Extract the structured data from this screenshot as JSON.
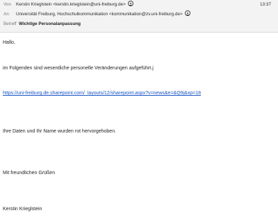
{
  "header": {
    "from_label": "Von",
    "from_value": "Kerstin Krieglstein <kerstin.krieglstein@uni-freiburg.de>",
    "to_label": "An",
    "to_value": "Universität Freiburg, Hochschulkommunikation <kommunikation@zv.uni-freiburg.de>",
    "subject_label": "Betreff",
    "subject_value": "Wichtige Personalanpassung",
    "time": "13:37",
    "icons": [
      "contact-icon",
      "contact-icon"
    ]
  },
  "body": {
    "greeting": "Hallo,",
    "intro": "im Folgenden sind wesentliche personelle Veränderungen aufgeführt.j",
    "link": "https://uni-freiburg.de.sharepoint.com/_layouts/12/sharepoint.aspx?v=news&e=&Q9j&xp=18",
    "note": "Ihre Daten und Ihr Name wurden rot hervorgehoben.",
    "closing": "Mit freundlichen Grüßen",
    "signature": "Kerstin Krieglstein"
  },
  "colors": {
    "link": "#1a56c9",
    "header_bg": "#f3f3f3"
  }
}
